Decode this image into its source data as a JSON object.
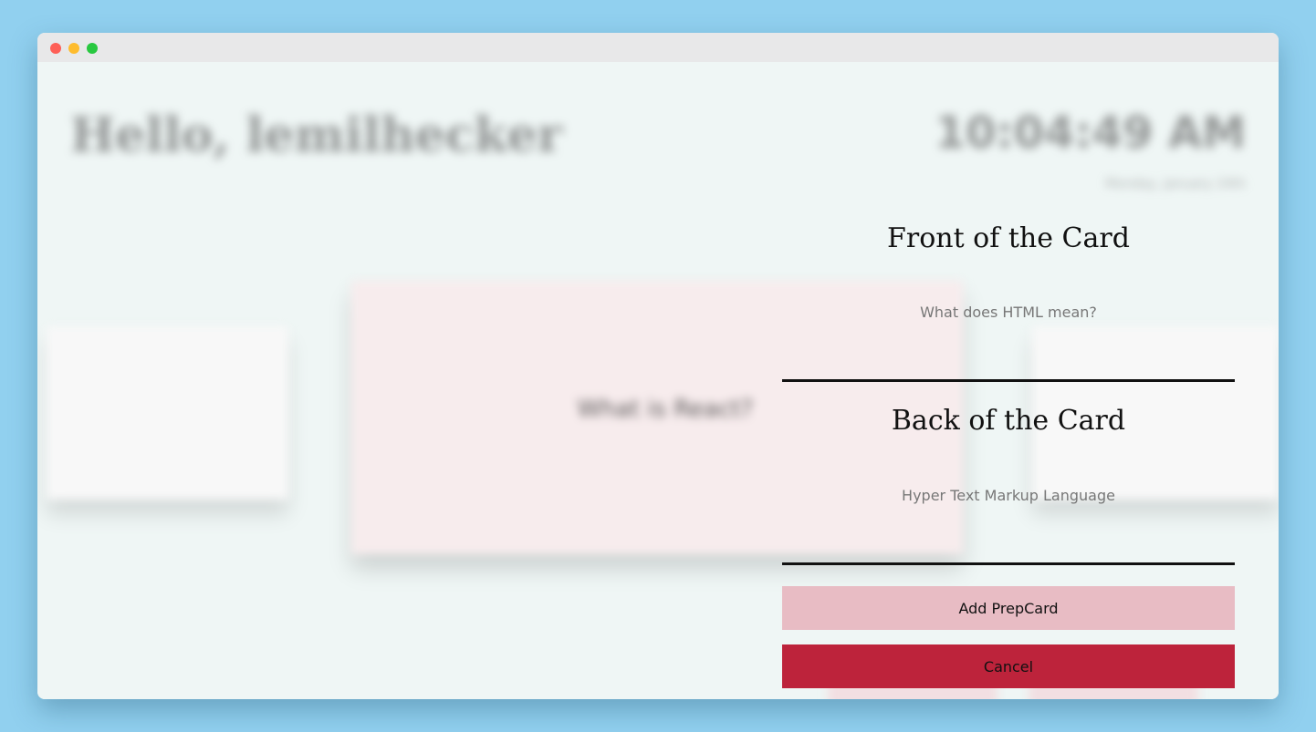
{
  "window": {
    "controls": [
      "close",
      "minimize",
      "zoom"
    ]
  },
  "background": {
    "greeting": "Hello, lemilhecker",
    "time": "10:04:49 AM",
    "date": "Monday, January 24th",
    "center_card_text": "What is React?"
  },
  "form": {
    "front_title": "Front of the Card",
    "front_value": "What does HTML mean?",
    "back_title": "Back of the Card",
    "back_value": "Hyper Text Markup Language",
    "add_button": "Add PrepCard",
    "cancel_button": "Cancel"
  },
  "colors": {
    "page_bg": "#91d0ef",
    "add_button": "#e8bcc4",
    "cancel_button": "#bd233b",
    "center_card": "#f7eced"
  }
}
